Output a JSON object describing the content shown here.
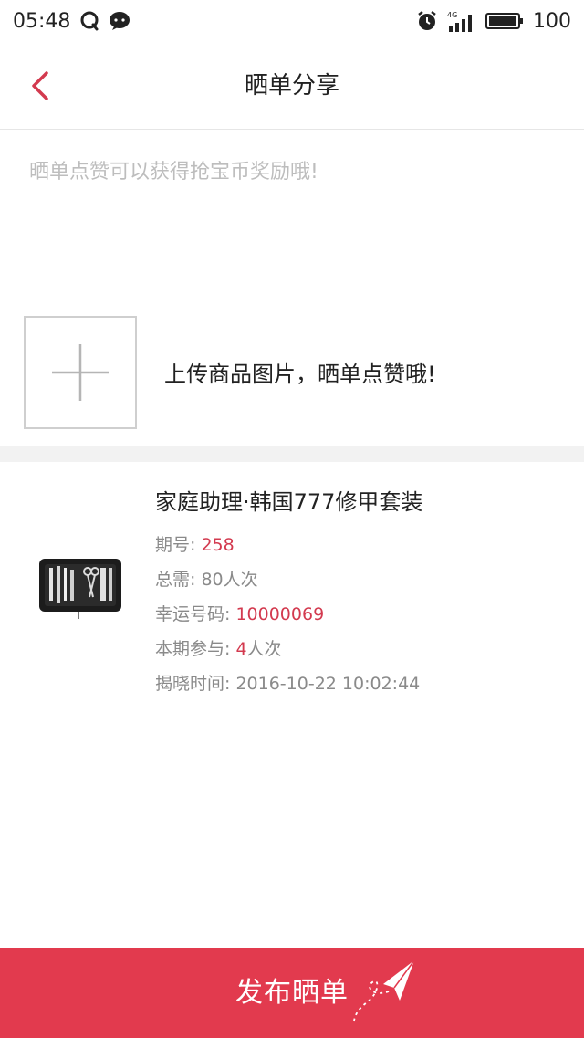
{
  "status_bar": {
    "time": "05:48",
    "network": "4G",
    "battery": "100"
  },
  "nav": {
    "title": "晒单分享"
  },
  "share": {
    "placeholder": "晒单点赞可以获得抢宝币奖励哦!",
    "value": ""
  },
  "upload": {
    "hint": "上传商品图片，晒单点赞哦!"
  },
  "product": {
    "title": "家庭助理·韩国777修甲套装",
    "period_label": "期号: ",
    "period_value": "258",
    "total_label": "总需: ",
    "total_value": "80人次",
    "lucky_label": "幸运号码: ",
    "lucky_value": "10000069",
    "participation_label": "本期参与: ",
    "participation_value": "4",
    "participation_unit": "人次",
    "reveal_label": "揭晓时间: ",
    "reveal_value": "2016-10-22 10:02:44"
  },
  "publish": {
    "label": "发布晒单"
  },
  "colors": {
    "accent": "#e23a4e",
    "highlight": "#d33a4f",
    "placeholder": "#bdbdbd",
    "muted": "#8a8a8a"
  },
  "icons": {
    "back": "chevron-left-icon",
    "add": "plus-icon",
    "plane": "paper-plane-icon",
    "alarm": "alarm-icon",
    "signal": "signal-icon",
    "battery": "battery-icon"
  }
}
